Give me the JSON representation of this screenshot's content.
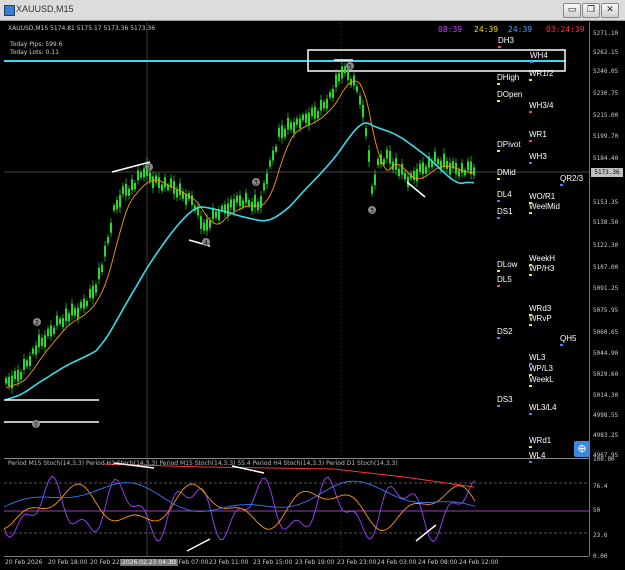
{
  "window": {
    "title": "XAUUSD,M15",
    "symbol_header": "XAUUSD,M15  5174.81 5175.17 5173.36 5173.36",
    "buttons": {
      "minimize": "▭",
      "restore": "❐",
      "close": "✕"
    }
  },
  "info": {
    "today_pips": "Today Pips: 599.6",
    "today_lots": "Today Lots: 0.11"
  },
  "clocks": [
    {
      "text": "08:39",
      "color": "#c040ff"
    },
    {
      "text": "24:39",
      "color": "#ffd700"
    },
    {
      "text": "24:39",
      "color": "#4aa0ff"
    },
    {
      "text": "03:24:39",
      "color": "#ff3030"
    }
  ],
  "current_price": "5173.36",
  "price_ticks": [
    "5271.10",
    "5262.15",
    "5246.05",
    "5230.75",
    "5215.00",
    "5199.70",
    "5184.40",
    "5168.65",
    "5153.35",
    "5138.50",
    "5122.30",
    "5107.00",
    "5091.25",
    "5075.95",
    "5060.65",
    "5044.90",
    "5029.60",
    "5014.30",
    "4998.55",
    "4983.25",
    "4967.95",
    "100.00",
    "76.4",
    "50",
    "23.6",
    "0.00"
  ],
  "time_ticks": [
    "20 Feb 2026",
    "20 Feb 18:00",
    "20 Feb 22:00",
    "2026.02.23 04:30",
    "23 Feb 07:00",
    "23 Feb 11:00",
    "23 Feb 15:00",
    "23 Feb 19:00",
    "23 Feb 23:00",
    "24 Feb 03:00",
    "24 Feb 08:00",
    "24 Feb 12:00"
  ],
  "levels": [
    {
      "label": "DH3",
      "color": "#ff4444"
    },
    {
      "label": "WH4",
      "color": "#4488ff"
    },
    {
      "label": "DHigh",
      "color": "#ffdd33"
    },
    {
      "label": "WR1/2",
      "color": "#ffdd33"
    },
    {
      "label": "DOpen",
      "color": "#ffdd33"
    },
    {
      "label": "WH3/4",
      "color": "#ff4444"
    },
    {
      "label": "WR1",
      "color": "#ff4444"
    },
    {
      "label": "DPivot",
      "color": "#ffdd33"
    },
    {
      "label": "WH3",
      "color": "#4488ff"
    },
    {
      "label": "DMid",
      "color": "#ffdd33"
    },
    {
      "label": "QR2/3",
      "color": "#4488ff"
    },
    {
      "label": "DL4",
      "color": "#4488ff"
    },
    {
      "label": "WO/R1",
      "color": "#ffdd33"
    },
    {
      "label": "WeelMid",
      "color": "#ffdd33"
    },
    {
      "label": "DS1",
      "color": "#4488ff"
    },
    {
      "label": "WeekH",
      "color": "#ffdd33"
    },
    {
      "label": "WP/H3",
      "color": "#ffdd33"
    },
    {
      "label": "DLow",
      "color": "#ffdd33"
    },
    {
      "label": "DL5",
      "color": "#ff4444"
    },
    {
      "label": "WRd3",
      "color": "#ffdd33"
    },
    {
      "label": "WRvP",
      "color": "#ffdd33"
    },
    {
      "label": "DS2",
      "color": "#4488ff"
    },
    {
      "label": "QH5",
      "color": "#4488ff"
    },
    {
      "label": "WL3",
      "color": "#4488ff"
    },
    {
      "label": "WP/L3",
      "color": "#ffdd33"
    },
    {
      "label": "WeekL",
      "color": "#ffdd33"
    },
    {
      "label": "DS3",
      "color": "#4488ff"
    },
    {
      "label": "WL3/L4",
      "color": "#4488ff"
    },
    {
      "label": "WRd1",
      "color": "#ffdd33"
    },
    {
      "label": "WL4",
      "color": "#4488ff"
    }
  ],
  "wave_labels": [
    "2",
    "1",
    "2",
    "4",
    "3",
    "5",
    "3"
  ],
  "oscillator_title": "Period M15 Stoch(14,3,3)  Period H1 Stoch(14,3,3)  Period M15 Stoch(14,3,3)  55.4  Period H4 Stoch(14,3,3)  Period D1 Stoch(14,3,3)",
  "colors": {
    "candle": "#22dd22",
    "ma_fast": "#ff9900",
    "ma_slow": "#33ddee",
    "stoch_purple": "#a040ff",
    "stoch_orange": "#ff9900",
    "stoch_blue": "#3377ff",
    "stoch_red": "#ff3333"
  },
  "nav_icon": "crosshair-icon"
}
